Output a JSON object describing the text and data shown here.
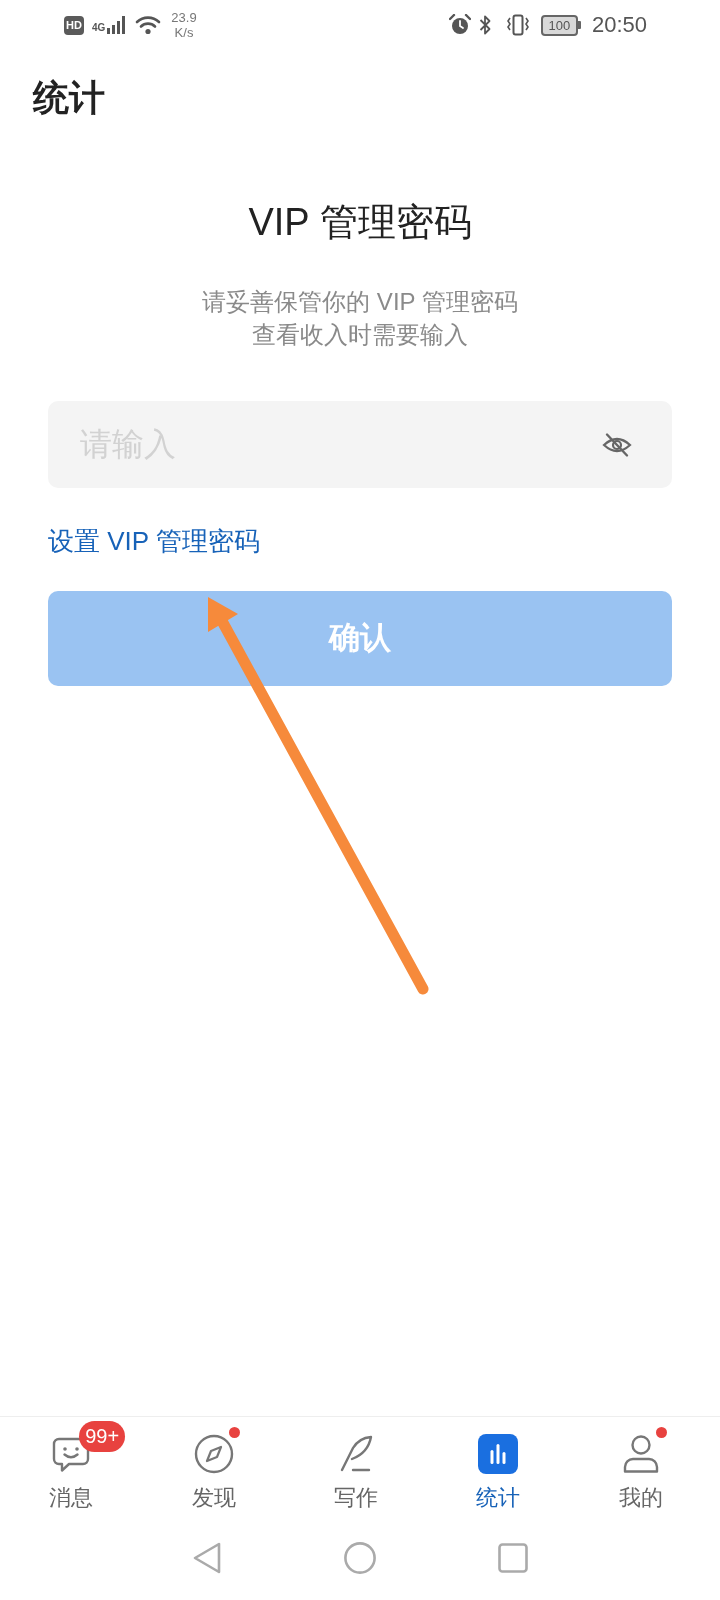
{
  "status_bar": {
    "hd": "HD",
    "network": "4G",
    "speed": "23.9",
    "speed_unit": "K/s",
    "battery": "100",
    "time": "20:50"
  },
  "header": {
    "title": "统计"
  },
  "vip_password": {
    "title": "VIP 管理密码",
    "description": [
      "请妥善保管你的 VIP 管理密码",
      "查看收入时需要输入"
    ],
    "password_field": {
      "placeholder": "请输入",
      "masked": true
    },
    "set_password_link": "设置 VIP 管理密码",
    "confirm_button": {
      "label": "确认",
      "disabled": true
    }
  },
  "bottom_nav": [
    {
      "label": "消息",
      "selected": false,
      "badge": "99+",
      "dot": false
    },
    {
      "label": "发现",
      "selected": false,
      "dot": true
    },
    {
      "label": "写作",
      "selected": false,
      "dot": false
    },
    {
      "label": "统计",
      "selected": true,
      "dot": false
    },
    {
      "label": "我的",
      "selected": false,
      "dot": true
    }
  ]
}
